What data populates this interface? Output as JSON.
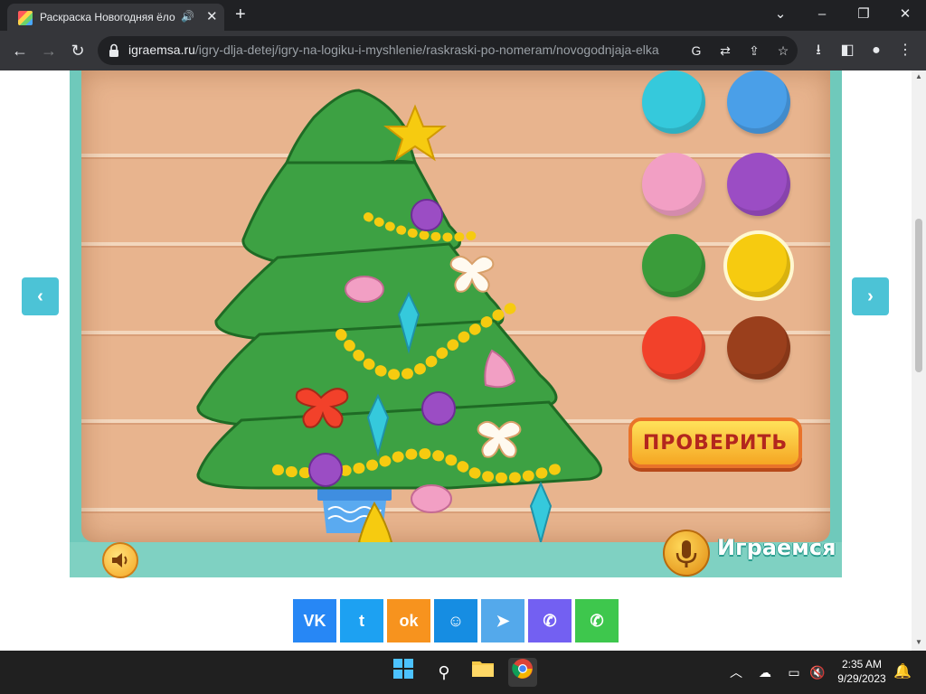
{
  "browser": {
    "tab_title": "Раскраска Новогодняя ёлочка",
    "new_tab_label": "+",
    "url_host": "igraemsa.ru",
    "url_path": "/igry-dlja-detej/igry-na-logiku-i-myshlenie/raskraski-po-nomeram/novogodnjaja-elka",
    "window_controls": {
      "minimize": "–",
      "restore": "❐",
      "close": "✕",
      "tab_list": "⌄"
    }
  },
  "game": {
    "prev_arrow": "‹",
    "next_arrow": "›",
    "check_button_label": "ПРОВЕРИТЬ",
    "brand_label": "Играемся",
    "palette": [
      {
        "name": "cyan",
        "color": "#35c9dc"
      },
      {
        "name": "blue",
        "color": "#4a9fe8"
      },
      {
        "name": "pink",
        "color": "#f29fc4"
      },
      {
        "name": "purple",
        "color": "#9b4dc4"
      },
      {
        "name": "green",
        "color": "#3a9c3a"
      },
      {
        "name": "yellow",
        "color": "#f6cb10",
        "selected": true
      },
      {
        "name": "red",
        "color": "#f2412a"
      },
      {
        "name": "brown",
        "color": "#9a3f1c"
      }
    ]
  },
  "share": [
    {
      "name": "vk",
      "label": "VK",
      "color": "#2787f5"
    },
    {
      "name": "twitter",
      "label": "t",
      "color": "#1da1f2"
    },
    {
      "name": "odnoklassniki",
      "label": "ok",
      "color": "#f7931e"
    },
    {
      "name": "moi-mir",
      "label": "☺",
      "color": "#168de2"
    },
    {
      "name": "telegram",
      "label": "➤",
      "color": "#54a9eb"
    },
    {
      "name": "viber",
      "label": "✆",
      "color": "#7360f2"
    },
    {
      "name": "whatsapp",
      "label": "✆",
      "color": "#3ec74d"
    }
  ],
  "taskbar": {
    "time": "2:35 AM",
    "date": "9/29/2023"
  }
}
